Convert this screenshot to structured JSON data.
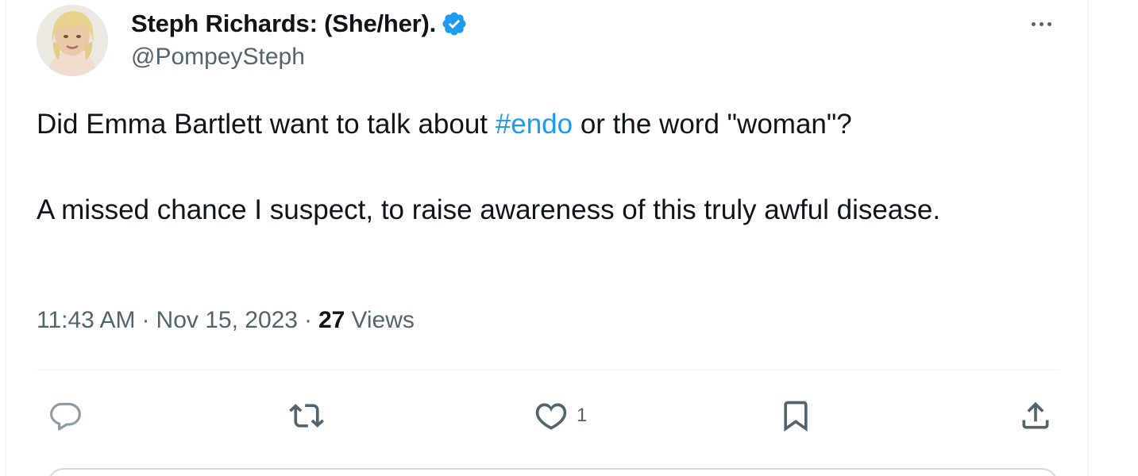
{
  "tweet": {
    "author": {
      "display_name": "Steph Richards: (She/her).",
      "handle": "@PompeySteph",
      "verified": true
    },
    "text": {
      "line1_before": "Did Emma Bartlett want to talk about ",
      "hashtag": "#endo",
      "line1_after": " or the word \"woman\"?",
      "para2": "A missed chance I suspect, to raise awareness of this truly awful disease."
    },
    "meta": {
      "time": "11:43 AM",
      "separator": "·",
      "date": "Nov 15, 2023",
      "views_count": "27",
      "views_label": "Views"
    },
    "actions": {
      "reply_count": "",
      "retweet_count": "",
      "like_count": "1",
      "bookmark_count": ""
    }
  },
  "icons": [
    "more-icon",
    "verified-icon",
    "reply-icon",
    "retweet-icon",
    "like-icon",
    "bookmark-icon",
    "share-icon"
  ],
  "colors": {
    "accent": "#1d9bf0",
    "text_primary": "#0f1419",
    "text_secondary": "#536471",
    "divider": "#eff3f4"
  }
}
